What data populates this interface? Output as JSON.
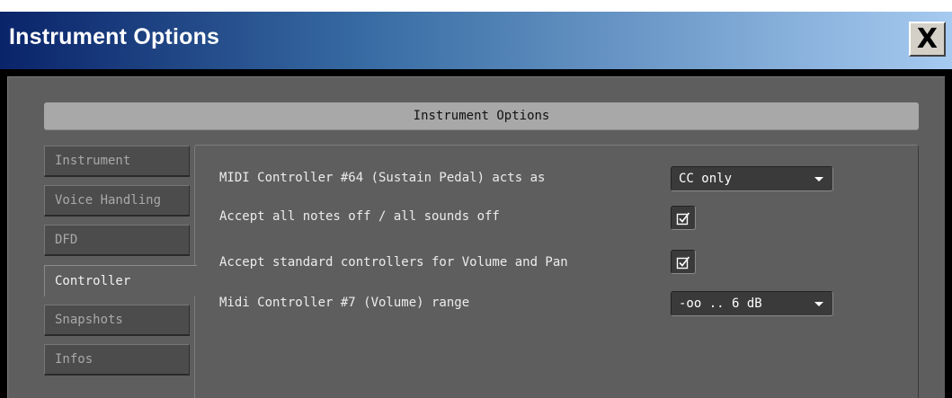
{
  "window": {
    "title": "Instrument Options",
    "close_label": "X"
  },
  "header": {
    "title": "Instrument Options"
  },
  "tabs": [
    {
      "label": "Instrument",
      "active": false
    },
    {
      "label": "Voice Handling",
      "active": false
    },
    {
      "label": "DFD",
      "active": false
    },
    {
      "label": "Controller",
      "active": true
    },
    {
      "label": "Snapshots",
      "active": false
    },
    {
      "label": "Infos",
      "active": false
    }
  ],
  "controller": {
    "sustain_label": "MIDI Controller #64 (Sustain Pedal) acts as",
    "sustain_value": "CC only",
    "notes_off_label": "Accept all notes off / all sounds off",
    "notes_off_checked": true,
    "std_ctrl_label": "Accept standard controllers for Volume and Pan",
    "std_ctrl_checked": true,
    "volume_range_label": "Midi Controller #7 (Volume) range",
    "volume_range_value": "-oo .. 6 dB"
  }
}
